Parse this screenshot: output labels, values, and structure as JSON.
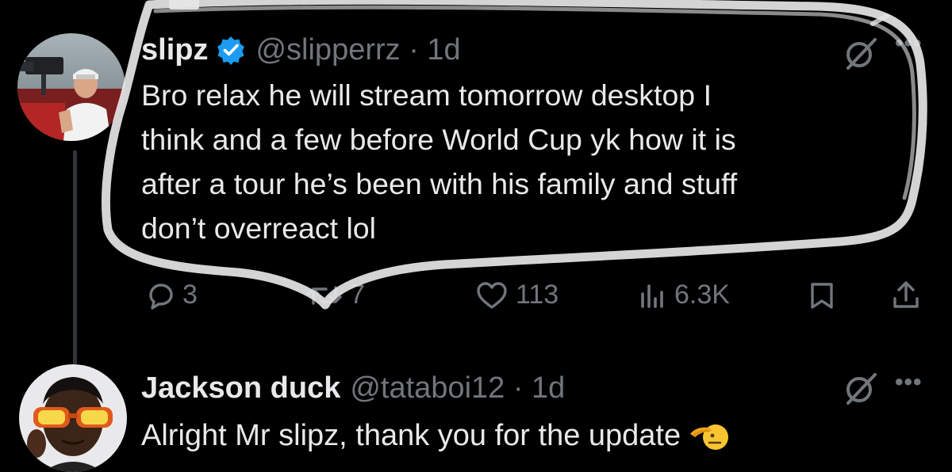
{
  "tweets": [
    {
      "display_name": "slipz",
      "verified": true,
      "handle_time": "@slipperrz · 1d",
      "lines": [
        "Bro relax he will stream tomorrow desktop I",
        "think and a few before World Cup yk how it is",
        "after a tour he’s been with his family and stuff",
        "don’t overreact lol"
      ],
      "replies": "3",
      "reposts": "7",
      "likes": "113",
      "views": "6.3K"
    },
    {
      "display_name": "Jackson duck",
      "handle_time": "@tataboi12 · 1d",
      "text": "Alright Mr slipz, thank you for the update"
    }
  ],
  "icons": {
    "grok": "grok-icon",
    "more": "more-icon",
    "reply": "reply-icon",
    "repost": "repost-icon",
    "like": "heart-icon",
    "views": "views-icon",
    "bookmark": "bookmark-icon",
    "share": "share-icon",
    "emoji": "saluting-face-emoji"
  },
  "colors": {
    "background": "#000000",
    "text": "#e7e9ea",
    "muted": "#71767b",
    "verified": "#1d9bf0",
    "scribble": "#e6e6e6"
  }
}
